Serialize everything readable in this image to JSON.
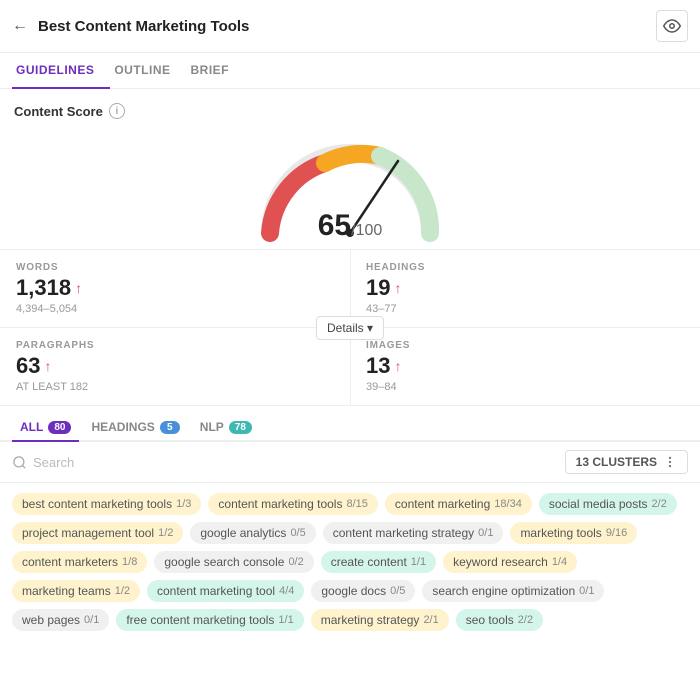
{
  "header": {
    "title": "Best Content Marketing Tools",
    "back_label": "←",
    "eye_icon": "eye"
  },
  "tabs": [
    {
      "label": "GUIDELINES",
      "active": true
    },
    {
      "label": "OUTLINE",
      "active": false
    },
    {
      "label": "BRIEF",
      "active": false
    }
  ],
  "content_score": {
    "label": "Content Score",
    "info": "i",
    "score": "65",
    "total": "/100"
  },
  "details_button": "Details ▾",
  "stats": [
    {
      "label": "WORDS",
      "value": "1,318",
      "range": "4,394–5,054"
    },
    {
      "label": "HEADINGS",
      "value": "19",
      "range": "43–77"
    },
    {
      "label": "PARAGRAPHS",
      "value": "63",
      "range": "AT LEAST 182"
    },
    {
      "label": "IMAGES",
      "value": "13",
      "range": "39–84"
    }
  ],
  "filter_tabs": [
    {
      "label": "ALL",
      "badge": "80",
      "active": true,
      "badge_color": "purple"
    },
    {
      "label": "HEADINGS",
      "badge": "5",
      "active": false,
      "badge_color": "blue"
    },
    {
      "label": "NLP",
      "badge": "78",
      "active": false,
      "badge_color": "teal"
    }
  ],
  "search": {
    "placeholder": "Search"
  },
  "clusters_label": "13 CLUSTERS",
  "tags": [
    {
      "text": "best content marketing tools",
      "count": "1/3",
      "color": "yellow"
    },
    {
      "text": "content marketing tools",
      "count": "8/15",
      "color": "yellow"
    },
    {
      "text": "content marketing",
      "count": "18/34",
      "color": "yellow"
    },
    {
      "text": "social media posts",
      "count": "2/2",
      "color": "green"
    },
    {
      "text": "project management tool",
      "count": "1/2",
      "color": "yellow"
    },
    {
      "text": "google analytics",
      "count": "0/5",
      "color": "plain"
    },
    {
      "text": "content marketing strategy",
      "count": "0/1",
      "color": "plain"
    },
    {
      "text": "marketing tools",
      "count": "9/16",
      "color": "yellow"
    },
    {
      "text": "content marketers",
      "count": "1/8",
      "color": "yellow"
    },
    {
      "text": "google search console",
      "count": "0/2",
      "color": "plain"
    },
    {
      "text": "create content",
      "count": "1/1",
      "color": "green"
    },
    {
      "text": "keyword research",
      "count": "1/4",
      "color": "yellow"
    },
    {
      "text": "marketing teams",
      "count": "1/2",
      "color": "yellow"
    },
    {
      "text": "content marketing tool",
      "count": "4/4",
      "color": "green"
    },
    {
      "text": "google docs",
      "count": "0/5",
      "color": "plain"
    },
    {
      "text": "search engine optimization",
      "count": "0/1",
      "color": "plain"
    },
    {
      "text": "web pages",
      "count": "0/1",
      "color": "plain"
    },
    {
      "text": "free content marketing tools",
      "count": "1/1",
      "color": "green"
    },
    {
      "text": "marketing strategy",
      "count": "2/1",
      "color": "yellow"
    },
    {
      "text": "seo tools",
      "count": "2/2",
      "color": "green"
    }
  ]
}
